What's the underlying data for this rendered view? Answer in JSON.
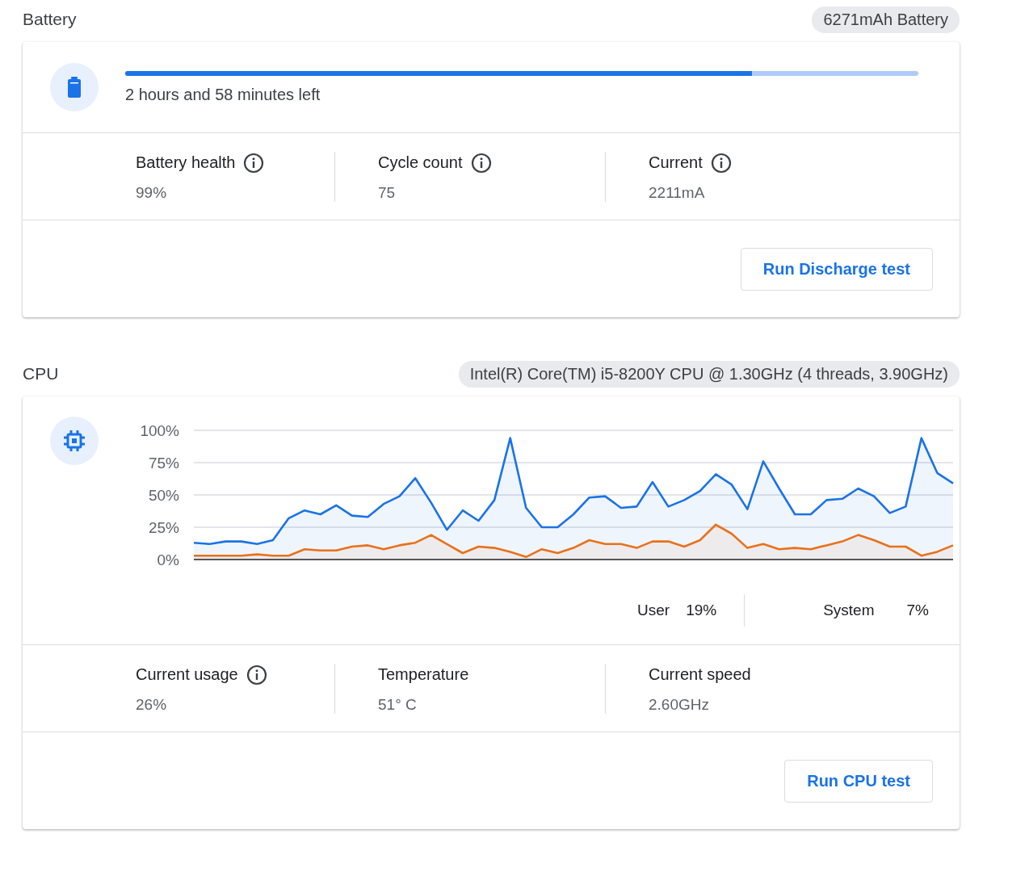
{
  "battery": {
    "title": "Battery",
    "badge": "6271mAh Battery",
    "charge": {
      "level": 0.79,
      "label": "2 hours and 58 minutes left"
    },
    "stats": [
      {
        "label": "Battery health",
        "value": "99%",
        "info": true
      },
      {
        "label": "Cycle count",
        "value": "75",
        "info": true
      },
      {
        "label": "Current",
        "value": "2211mA",
        "info": true
      }
    ],
    "button": "Run Discharge test"
  },
  "cpu": {
    "title": "CPU",
    "badge": "Intel(R) Core(TM) i5-8200Y CPU @ 1.30GHz (4 threads, 3.90GHz)",
    "chart_data": {
      "type": "area",
      "ylim": [
        0,
        100
      ],
      "yticks": [
        {
          "value": 0,
          "label": "0%"
        },
        {
          "value": 25,
          "label": "25%"
        },
        {
          "value": 50,
          "label": "50%"
        },
        {
          "value": 75,
          "label": "75%"
        },
        {
          "value": 100,
          "label": "100%"
        }
      ],
      "grid": true,
      "series": [
        {
          "name": "User",
          "color": "#1a73e8",
          "values": [
            13,
            12,
            14,
            14,
            12,
            15,
            32,
            38,
            35,
            42,
            34,
            33,
            43,
            49,
            63,
            44,
            23,
            38,
            30,
            46,
            94,
            40,
            25,
            25,
            35,
            48,
            49,
            40,
            41,
            60,
            41,
            46,
            53,
            66,
            58,
            39,
            76,
            55,
            35,
            35,
            46,
            47,
            55,
            49,
            36,
            41,
            94,
            67,
            59
          ]
        },
        {
          "name": "System",
          "color": "#e8711a",
          "values": [
            3,
            3,
            3,
            3,
            4,
            3,
            3,
            8,
            7,
            7,
            10,
            11,
            8,
            11,
            13,
            19,
            12,
            5,
            10,
            9,
            6,
            2,
            8,
            5,
            9,
            15,
            12,
            12,
            9,
            14,
            14,
            10,
            15,
            27,
            20,
            9,
            12,
            8,
            9,
            8,
            11,
            14,
            19,
            15,
            10,
            10,
            3,
            6,
            11
          ]
        }
      ]
    },
    "legend_values": [
      "19%",
      "7%"
    ],
    "stats": [
      {
        "label": "Current usage",
        "value": "26%",
        "info": true
      },
      {
        "label": "Temperature",
        "value": "51° C",
        "info": false
      },
      {
        "label": "Current speed",
        "value": "2.60GHz",
        "info": false
      }
    ],
    "button": "Run CPU test"
  }
}
